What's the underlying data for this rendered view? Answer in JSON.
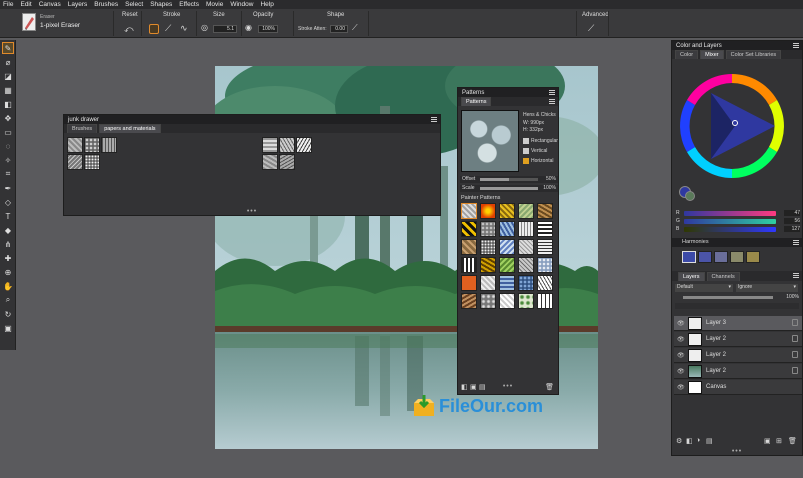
{
  "menu": [
    "File",
    "Edit",
    "Canvas",
    "Layers",
    "Brushes",
    "Select",
    "Shapes",
    "Effects",
    "Movie",
    "Window",
    "Help"
  ],
  "propbar": {
    "brush_category": "Eraser",
    "brush_variant": "1-pixel Eraser",
    "reset": "Reset",
    "stroke": "Stroke",
    "size": "Size",
    "size_value": "5.1",
    "opacity": "Opacity",
    "opacity_value": "100%",
    "shape": "Shape",
    "stroke_attenuation": "Stroke Atten:",
    "stroke_attenuation_value": "0.00",
    "advanced": "Advanced"
  },
  "junk_drawer": {
    "title": "junk drawer",
    "tabs": [
      "Brushes",
      "papers and materials"
    ]
  },
  "patterns_panel": {
    "title": "Patterns",
    "tab": "Patterns",
    "preview_name": "Hens & Chicks",
    "preview_w": "W: 990px",
    "preview_h": "H: 332px",
    "options": [
      "Rectangular",
      "Vertical",
      "Horizontal"
    ],
    "offset_label": "Offset",
    "offset_value": "50%",
    "scale_label": "Scale",
    "scale_value": "100%",
    "library_title": "Painter Patterns"
  },
  "color_panel": {
    "title": "Color and Layers",
    "tabs": [
      "Color",
      "Mixer",
      "Color Set Libraries"
    ],
    "sliders": [
      {
        "label": "R",
        "value": "47"
      },
      {
        "label": "G",
        "value": "56"
      },
      {
        "label": "B",
        "value": "127"
      }
    ],
    "hue_accent": "#2f38a0"
  },
  "harmonies": {
    "title": "Harmonies",
    "swatches": [
      "#3c4aa8",
      "#4b54a8",
      "#6a6e9a",
      "#8a8a6a",
      "#9a8a4a"
    ]
  },
  "layers_panel": {
    "tabs": [
      "Layers",
      "Channels"
    ],
    "composite": "Default",
    "method": "Ignore",
    "opacity": "100%",
    "layers": [
      "Layer 3",
      "Layer 2",
      "Layer 2",
      "Layer 2",
      "Canvas"
    ]
  },
  "watermark": {
    "text": "FileOur.com"
  }
}
